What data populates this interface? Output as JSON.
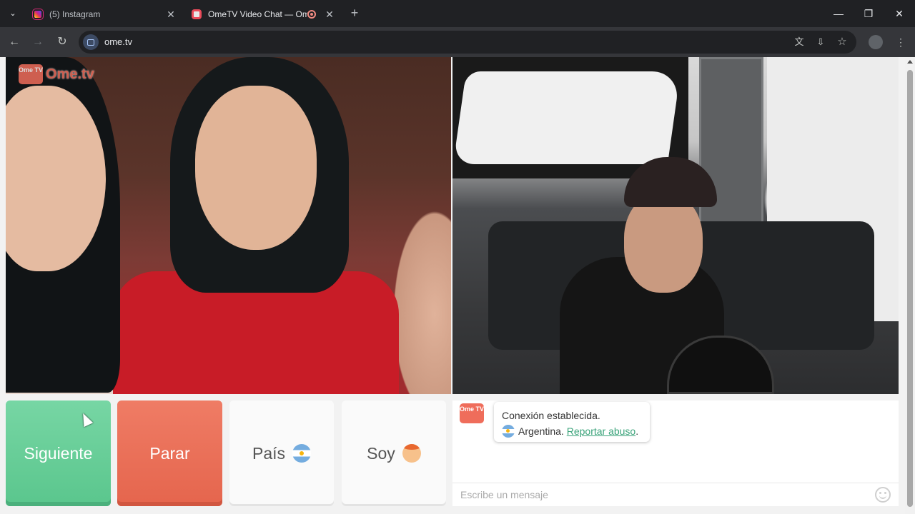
{
  "browser": {
    "tabs": [
      {
        "title": "(5) Instagram",
        "close": "✕"
      },
      {
        "title": "OmeTV Video Chat — Ome",
        "close": "✕"
      }
    ],
    "new_tab": "+",
    "window_controls": {
      "minimize": "—",
      "maximize": "❐",
      "close": "✕"
    },
    "nav": {
      "back": "←",
      "forward": "→",
      "reload": "↻"
    },
    "url": "ome.tv",
    "icons": [
      "tab-search-icon",
      "instagram-icon",
      "ometv-icon",
      "recording-icon",
      "site-info-icon",
      "translate-icon",
      "install-icon",
      "star-icon",
      "profile-icon",
      "menu-icon"
    ]
  },
  "watermark": {
    "badge": "Ome TV",
    "text": "Ome.tv"
  },
  "buttons": {
    "next": "Siguiente",
    "stop": "Parar",
    "country": "País",
    "gender": "Soy"
  },
  "chat": {
    "logo": "Ome TV",
    "status": "Conexión establecida.",
    "country": "Argentina.",
    "report_link": "Reportar abuso",
    "report_suffix": ".",
    "input_placeholder": "Escribe un mensaje"
  },
  "colors": {
    "next": "#5ac68d",
    "stop": "#e5654d",
    "brand": "#ef6d5b",
    "link": "#3aa37a"
  }
}
